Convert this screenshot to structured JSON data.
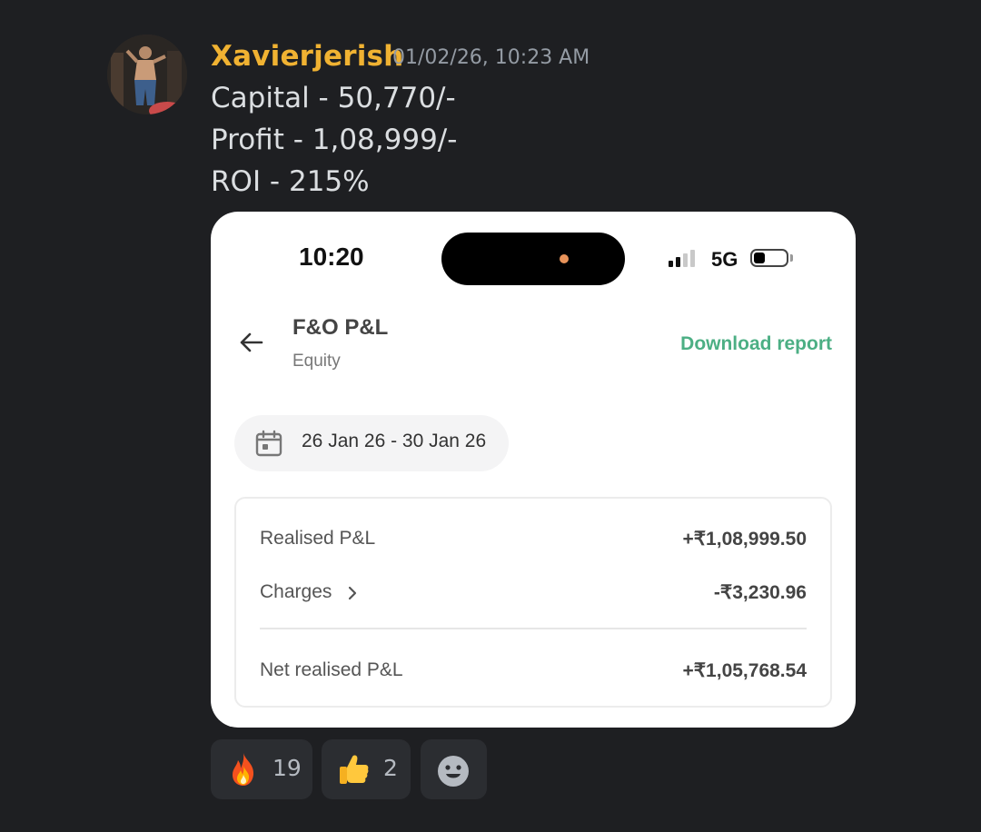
{
  "message": {
    "author": "Xavierjerish",
    "timestamp": "01/02/26, 10:23 AM",
    "lines": [
      "Capital - 50,770/-",
      "Profit - 1,08,999/-",
      "ROI - 215%"
    ],
    "author_color": "#f0b232"
  },
  "attachment": {
    "status_bar": {
      "time": "10:20",
      "network": "5G"
    },
    "header": {
      "title": "F&O P&L",
      "subtitle": "Equity",
      "download_label": "Download report"
    },
    "date_range": "26 Jan 26 - 30 Jan 26",
    "summary": {
      "realised_label": "Realised P&L",
      "realised_value": "+₹1,08,999.50",
      "charges_label": "Charges",
      "charges_value": "-₹3,230.96",
      "net_label": "Net realised P&L",
      "net_value": "+₹1,05,768.54"
    },
    "accent_color": "#4caf84"
  },
  "reactions": [
    {
      "emoji": "fire-icon",
      "count": "19"
    },
    {
      "emoji": "thumbs-up-icon",
      "count": "2"
    },
    {
      "emoji": "add-reaction-icon",
      "count": ""
    }
  ]
}
